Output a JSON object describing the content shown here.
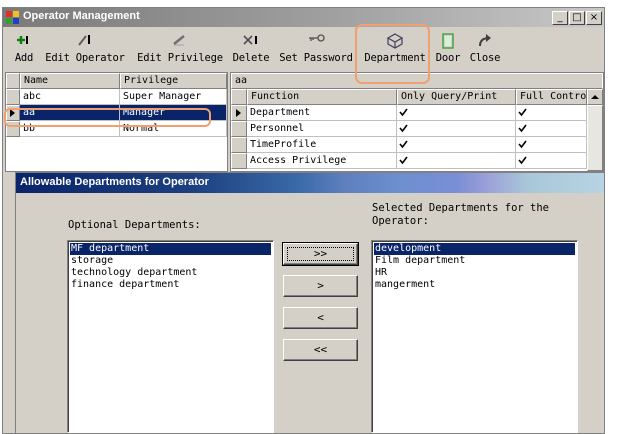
{
  "window": {
    "title": "Operator Management",
    "controls": {
      "minimize": "_",
      "maximize": "□",
      "close": "×"
    }
  },
  "toolbar": {
    "items": [
      {
        "label": "Add",
        "icon": "add-icon"
      },
      {
        "label": "Edit Operator",
        "icon": "edit-operator-icon"
      },
      {
        "label": "Edit Privilege",
        "icon": "edit-privilege-icon"
      },
      {
        "label": "Delete",
        "icon": "delete-icon"
      },
      {
        "label": "Set Password",
        "icon": "key-icon"
      },
      {
        "label": "Department",
        "icon": "department-icon"
      },
      {
        "label": "Door",
        "icon": "door-icon"
      },
      {
        "label": "Close",
        "icon": "close-arrow-icon"
      }
    ],
    "highlight_color": "#f0a070"
  },
  "operators": {
    "columns": [
      "Name",
      "Privilege"
    ],
    "rows": [
      {
        "name": "abc",
        "privilege": "Super Manager"
      },
      {
        "name": "aa",
        "privilege": "Manager"
      },
      {
        "name": "bb",
        "privilege": "Normal"
      }
    ],
    "selected_index": 1
  },
  "privileges": {
    "header": "aa",
    "columns": [
      "Function",
      "Only Query/Print",
      "Full Contro"
    ],
    "rows": [
      {
        "function": "Department",
        "query": true,
        "full": true
      },
      {
        "function": "Personnel",
        "query": true,
        "full": true
      },
      {
        "function": "TimeProfile",
        "query": true,
        "full": true
      },
      {
        "function": "Access Privilege",
        "query": true,
        "full": true
      }
    ]
  },
  "dialog": {
    "title": "Allowable Departments for Operator",
    "optional_label": "Optional Departments:",
    "selected_label_line1": "Selected Departments for the",
    "selected_label_line2": "Operator:",
    "optional_items": [
      "MF department",
      "storage",
      "technology department",
      "finance department"
    ],
    "optional_selected_index": 0,
    "selected_items": [
      "development",
      "Film department",
      "HR",
      "mangerment"
    ],
    "selected_selected_index": 0,
    "buttons": {
      "add_all": ">>",
      "add": ">",
      "remove": "<",
      "remove_all": "<<"
    }
  }
}
